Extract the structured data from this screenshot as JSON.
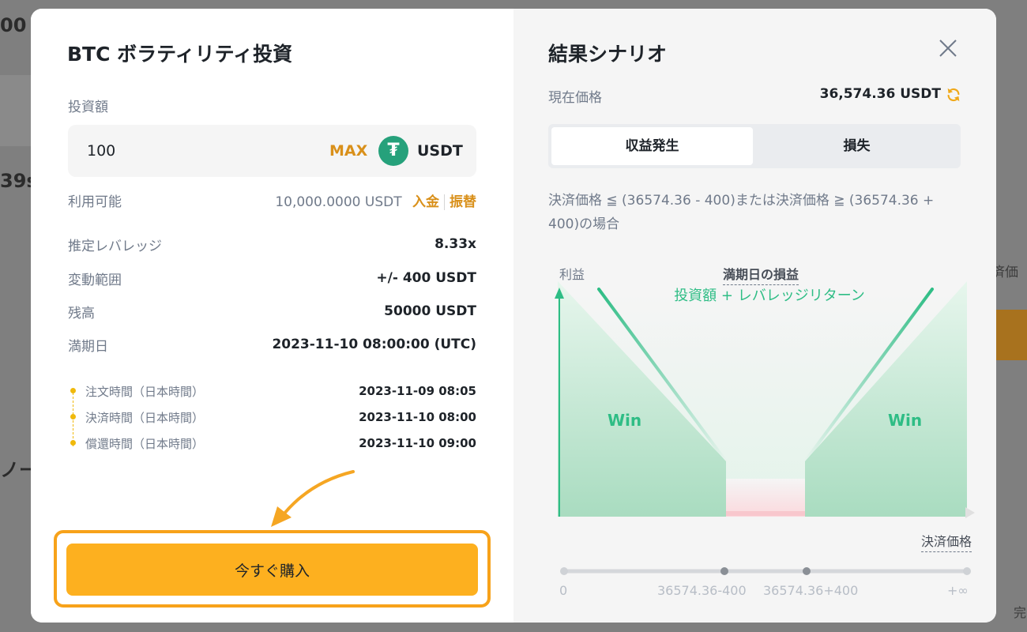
{
  "backdrop": {
    "frag_left_top": "00",
    "frag_left_mid": "39s",
    "frag_left_low": "ノー",
    "frag_top_a": "利益",
    "frag_top_b": "満期日の損益",
    "frag_right_mid": "済価",
    "frag_right_bottom": "完"
  },
  "left": {
    "title": "BTC ボラティリティ投資",
    "amount_label": "投資額",
    "amount_value": "100",
    "max_label": "MAX",
    "currency": "USDT",
    "available_label": "利用可能",
    "available_value": "10,000.0000 USDT",
    "deposit_label": "入金",
    "transfer_label": "振替",
    "rows": [
      {
        "label": "推定レバレッジ",
        "value": "8.33x"
      },
      {
        "label": "変動範囲",
        "value": "+/- 400 USDT"
      },
      {
        "label": "残高",
        "value": "50000 USDT"
      },
      {
        "label": "満期日",
        "value": "2023-11-10 08:00:00 (UTC)"
      }
    ],
    "timeline": [
      {
        "label": "注文時間（日本時間）",
        "value": "2023-11-09 08:05"
      },
      {
        "label": "決済時間（日本時間）",
        "value": "2023-11-10 08:00"
      },
      {
        "label": "償還時間（日本時間）",
        "value": "2023-11-10 09:00"
      }
    ],
    "buy_label": "今すぐ購入"
  },
  "right": {
    "title": "結果シナリオ",
    "current_price_label": "現在価格",
    "current_price_value": "36,574.36 USDT",
    "tabs": [
      "収益発生",
      "損失"
    ],
    "description": "決済価格 ≦ (36574.36 - 400)または決済価格 ≧ (36574.36 + 400)の場合",
    "chart": {
      "y_label": "利益",
      "title": "満期日の損益",
      "annotation": "投資額 + レバレッジリターン",
      "win_left": "Win",
      "win_right": "Win",
      "x_label": "決済価格",
      "ticks": [
        "0",
        "36574.36-400",
        "36574.36+400",
        "+∞"
      ]
    }
  },
  "colors": {
    "accent": "#FDB01F",
    "win_green": "#2EBD85",
    "link_orange": "#D9901A",
    "text": "#1E2329",
    "muted": "#707A8A"
  }
}
